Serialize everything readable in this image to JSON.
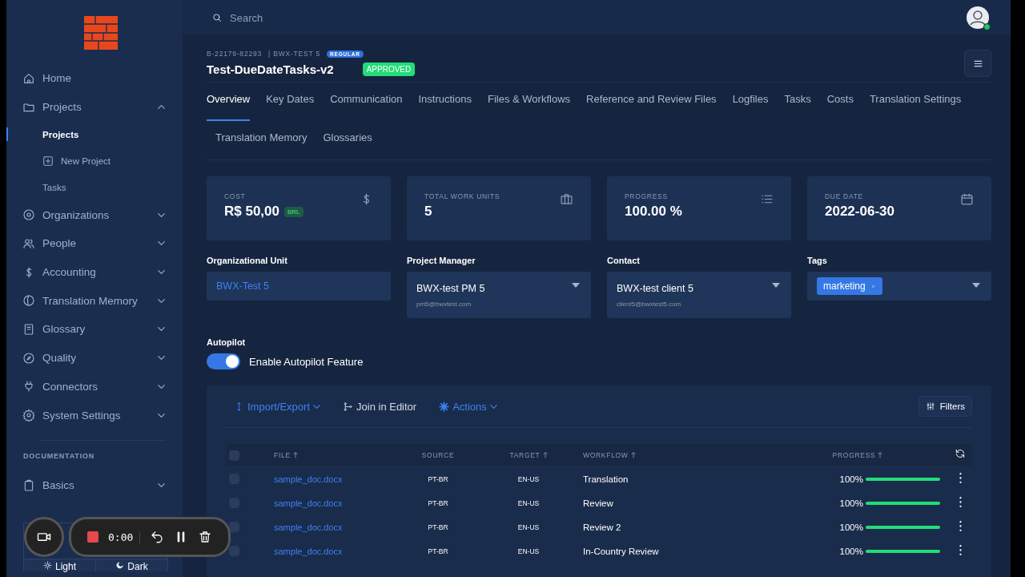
{
  "sidebar": {
    "nav": [
      {
        "label": "Home"
      },
      {
        "label": "Projects",
        "expanded": true,
        "children": [
          {
            "label": "Projects",
            "selected": true,
            "kind": "link"
          },
          {
            "label": "New Project",
            "selected": false,
            "kind": "add"
          },
          {
            "label": "Tasks",
            "selected": false,
            "kind": "link"
          }
        ]
      },
      {
        "label": "Organizations",
        "expanded": false
      },
      {
        "label": "People",
        "expanded": false
      },
      {
        "label": "Accounting",
        "expanded": false
      },
      {
        "label": "Translation Memory",
        "expanded": false
      },
      {
        "label": "Glossary",
        "expanded": false
      },
      {
        "label": "Quality",
        "expanded": false
      },
      {
        "label": "Connectors",
        "expanded": false
      },
      {
        "label": "System Settings",
        "expanded": false
      }
    ],
    "section": "DOCUMENTATION",
    "docs": [
      {
        "label": "Basics",
        "expanded": false
      }
    ],
    "theme": [
      {
        "label": "Light"
      },
      {
        "label": "Dark"
      }
    ]
  },
  "recorder": {
    "time": "0:00"
  },
  "topbar": {
    "search": {
      "placeholder": "Search"
    }
  },
  "project": {
    "number": "B-22179-82293",
    "org": "| BWX-TEST 5",
    "type": "REGULAR",
    "title": "Test-DueDateTasks-v2",
    "status": "APPROVED"
  },
  "tab_rows": [
    [
      {
        "label": "Overview",
        "selected": true
      },
      {
        "label": "Key Dates",
        "selected": false
      },
      {
        "label": "Communication",
        "selected": false
      },
      {
        "label": "Instructions",
        "selected": false
      },
      {
        "label": "Files & Workflows",
        "selected": false
      },
      {
        "label": "Reference and Review Files",
        "selected": false
      },
      {
        "label": "Logfiles",
        "selected": false
      },
      {
        "label": "Tasks",
        "selected": false
      },
      {
        "label": "Costs",
        "selected": false
      },
      {
        "label": "Translation Settings",
        "selected": false
      }
    ],
    [
      {
        "label": "Translation Memory",
        "selected": false
      },
      {
        "label": "Glossaries",
        "selected": false
      }
    ]
  ],
  "stats": [
    {
      "label": "COST",
      "value": "R$ 50,00",
      "currency": "BRL"
    },
    {
      "label": "TOTAL WORK UNITS",
      "value": "5"
    },
    {
      "label": "PROGRESS",
      "value": "100.00 %"
    },
    {
      "label": "DUE DATE",
      "value": "2022-06-30"
    }
  ],
  "fields": [
    {
      "kind": "text",
      "label": "Organizational Unit",
      "value": "BWX-Test 5"
    },
    {
      "kind": "select",
      "label": "Project Manager",
      "value": "BWX-test PM 5",
      "detail": "pm5@bwxtest.com"
    },
    {
      "kind": "select",
      "label": "Contact",
      "value": "BWX-test client 5",
      "detail": "client5@bwxtest5.com"
    },
    {
      "kind": "tags",
      "label": "Tags",
      "tags": [
        "marketing"
      ]
    }
  ],
  "autopilot": {
    "label": "Autopilot",
    "toggle_label": "Enable Autopilot Feature",
    "on": true
  },
  "toolbar": {
    "actions": [
      {
        "label": "Import/Export",
        "menu": true
      },
      {
        "label": "Join in Editor",
        "menu": false
      },
      {
        "label": "Actions",
        "menu": true
      }
    ],
    "filters": "Filters"
  },
  "table": {
    "all_checked": false,
    "columns": [
      {
        "label": "FILE",
        "sorted": true
      },
      {
        "label": "SOURCE",
        "sorted": false
      },
      {
        "label": "TARGET",
        "sorted": true
      },
      {
        "label": "WORKFLOW",
        "sorted": true
      },
      {
        "label": "PROGRESS",
        "sorted": true
      }
    ],
    "rows": [
      {
        "checked": false,
        "file": "sample_doc.docx",
        "source": "PT-BR",
        "target": "EN-US",
        "workflow": "Translation",
        "progress": "100%",
        "level": 1
      },
      {
        "checked": false,
        "file": "sample_doc.docx",
        "source": "PT-BR",
        "target": "EN-US",
        "workflow": "Review",
        "progress": "100%",
        "level": 1
      },
      {
        "checked": false,
        "file": "sample_doc.docx",
        "source": "PT-BR",
        "target": "EN-US",
        "workflow": "Review 2",
        "progress": "100%",
        "level": 1
      },
      {
        "checked": false,
        "file": "sample_doc.docx",
        "source": "PT-BR",
        "target": "EN-US",
        "workflow": "In-Country Review",
        "progress": "100%",
        "level": 1
      }
    ]
  }
}
